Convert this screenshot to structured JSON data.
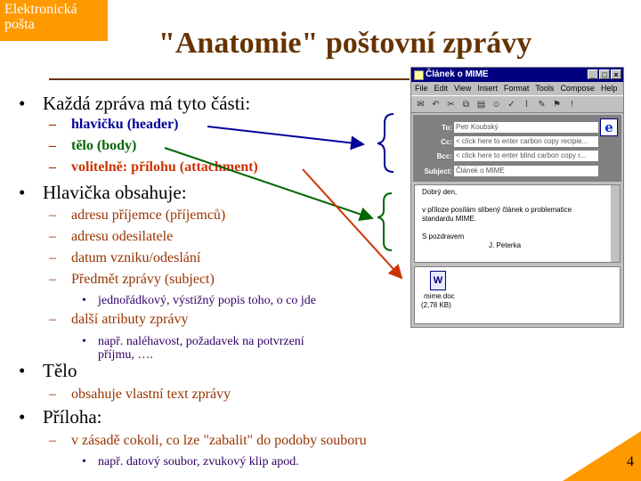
{
  "corner_label": [
    "Elektronická",
    "pošta"
  ],
  "title": "\"Anatomie\" poštovní zprávy",
  "page_number": "4",
  "colors": {
    "accent": "#ff9900",
    "title": "#663300",
    "level2": "#993300",
    "blue": "#000099",
    "green": "#006600",
    "red": "#cc3300"
  },
  "outline": {
    "parts_heading": "Každá zpráva má tyto části:",
    "parts": [
      {
        "label": "hlavičku (header)",
        "color": "#000099"
      },
      {
        "label": "tělo (body)",
        "color": "#006600"
      },
      {
        "label": "volitelně: přílohu (attachment)",
        "color": "#cc3300"
      }
    ],
    "header_heading": "Hlavička obsahuje:",
    "header_items": {
      "recipient": "adresu příjemce (příjemců)",
      "sender": "adresu odesilatele",
      "date": "datum vzniku/odeslání",
      "subject": "Předmět zprávy (subject)",
      "subject_note": "jednořádkový, výstižný popis toho, o co jde",
      "other": "další atributy zprávy",
      "other_note": [
        "např. naléhavost, požadavek na potvrzení",
        "příjmu, …."
      ]
    },
    "body_heading": "Tělo",
    "body_item": "obsahuje vlastní text zprávy",
    "attach_heading": "Příloha:",
    "attach_item": "v zásadě cokoli, co lze \"zabalit\" do podoby souboru",
    "attach_note": "např. datový soubor, zvukový klip apod."
  },
  "email_window": {
    "title": "Článek o MIME",
    "menu": [
      "File",
      "Edit",
      "View",
      "Insert",
      "Format",
      "Tools",
      "Compose",
      "Help"
    ],
    "header_fields": [
      {
        "label": "To:",
        "value": "Petr Koubský"
      },
      {
        "label": "Cc:",
        "value": "< click here to enter carbon copy recipie..."
      },
      {
        "label": "Bcc:",
        "value": "< click here to enter blind carbon copy r..."
      },
      {
        "label": "Subject:",
        "value": "Článek o MIME"
      }
    ],
    "body_lines": [
      "Dobrý den,",
      "",
      "v příloze posílám slíbený článek o problematice",
      "standardu MIME.",
      "",
      "S pozdravem"
    ],
    "signature": "J. Peterka",
    "attachment_name": "mime.doc",
    "attachment_size": "(2,78 KB)"
  }
}
